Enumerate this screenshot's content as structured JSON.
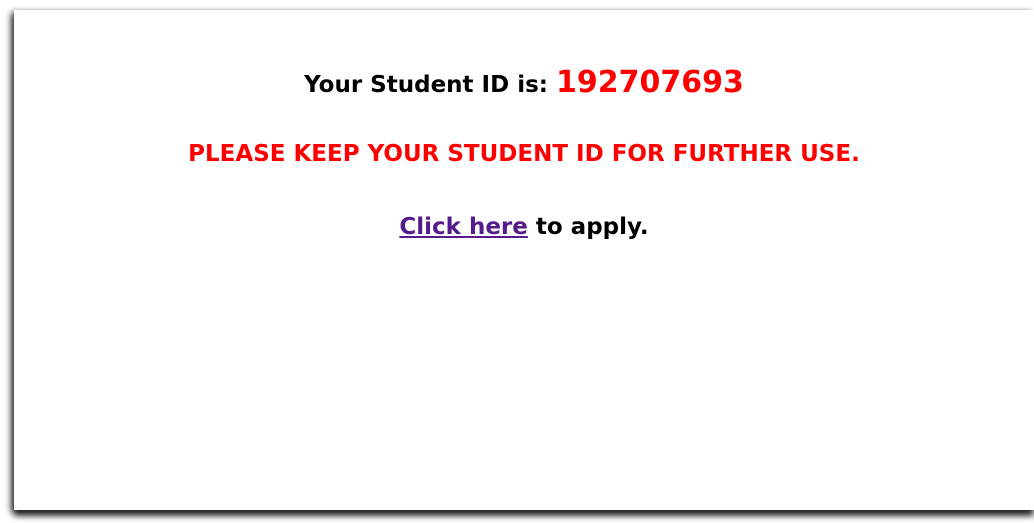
{
  "student_id": {
    "label": "Your Student ID is:",
    "value": "192707693"
  },
  "warning": {
    "text": "PLEASE KEEP YOUR STUDENT ID FOR FURTHER USE."
  },
  "apply": {
    "link_text": "Click here",
    "suffix": " to apply."
  },
  "colors": {
    "id_value": "#ff0000",
    "warning": "#ff0000",
    "link": "#551a8b",
    "text": "#000000",
    "background": "#ffffff"
  }
}
